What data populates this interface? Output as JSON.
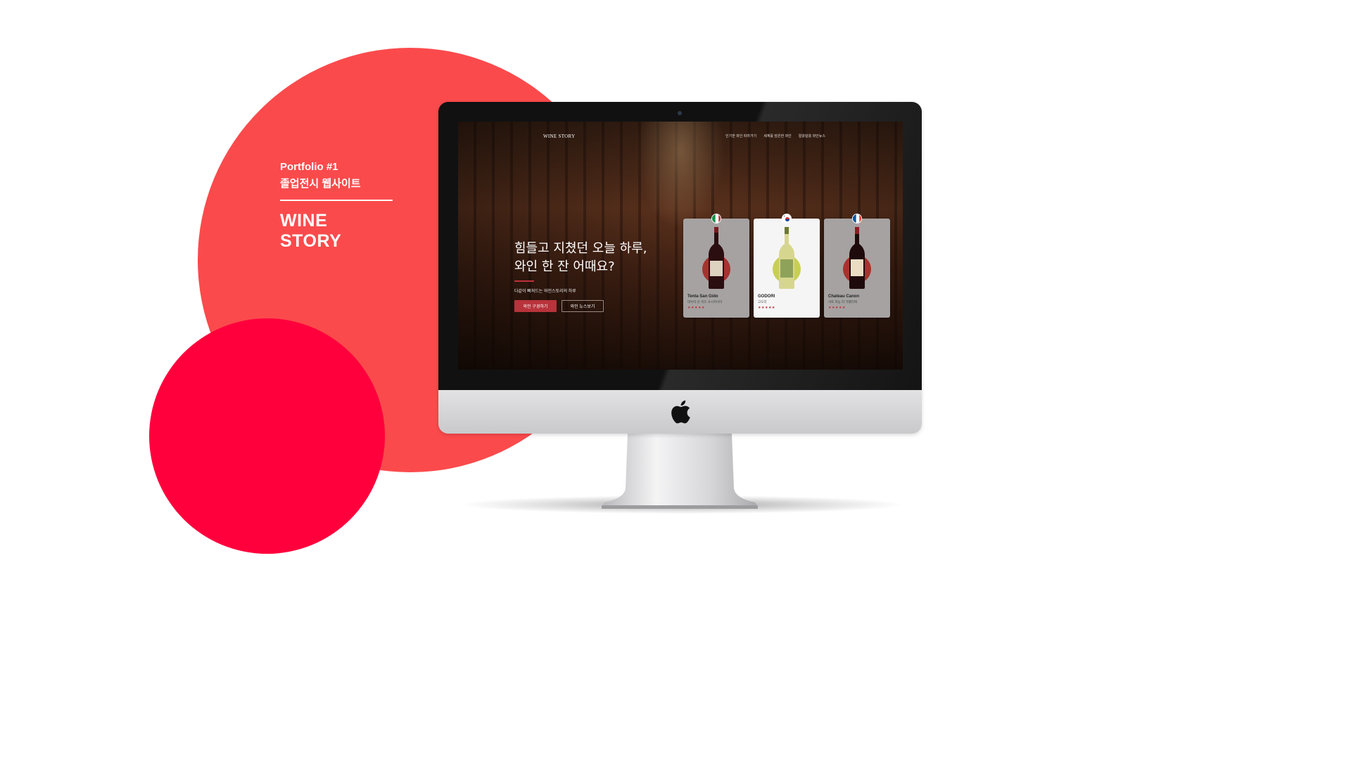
{
  "portfolio": {
    "number": "Portfolio #1",
    "subtitle": "졸업전시 웹사이트",
    "title": "WINE STORY"
  },
  "site": {
    "logo": "WINE STORY",
    "nav": [
      "인기한 와인 따라가기",
      "세계를 담은한 와인",
      "알쏭달쏭 와인뉴스"
    ],
    "headline_1": "힘들고 지쳤던 오늘 하루,",
    "headline_2": "와인 한 잔 어때요?",
    "subtext": "다같이 빠져드는 와인스토리의 하루",
    "button_primary": "와인 구경하기",
    "button_secondary": "와인 뉴스보기",
    "wines": [
      {
        "name": "Tenta San Gido",
        "desc": "테누타 산 귀도 사시카이아",
        "stars": "★★★★★",
        "flag": "italy",
        "highlighted": false
      },
      {
        "name": "GODORI",
        "desc": "고도리",
        "stars": "★★★★★",
        "flag": "korea",
        "highlighted": true
      },
      {
        "name": "Chateau Canon",
        "desc": "샤토 카농 라 가펠리에",
        "stars": "★★★★★",
        "flag": "france",
        "highlighted": false
      }
    ]
  },
  "colors": {
    "big_circle": "#fb4a4c",
    "small_circle": "#ff003d",
    "accent_button": "#b8333b"
  },
  "icons": {
    "monitor_logo": "apple-logo-icon"
  }
}
